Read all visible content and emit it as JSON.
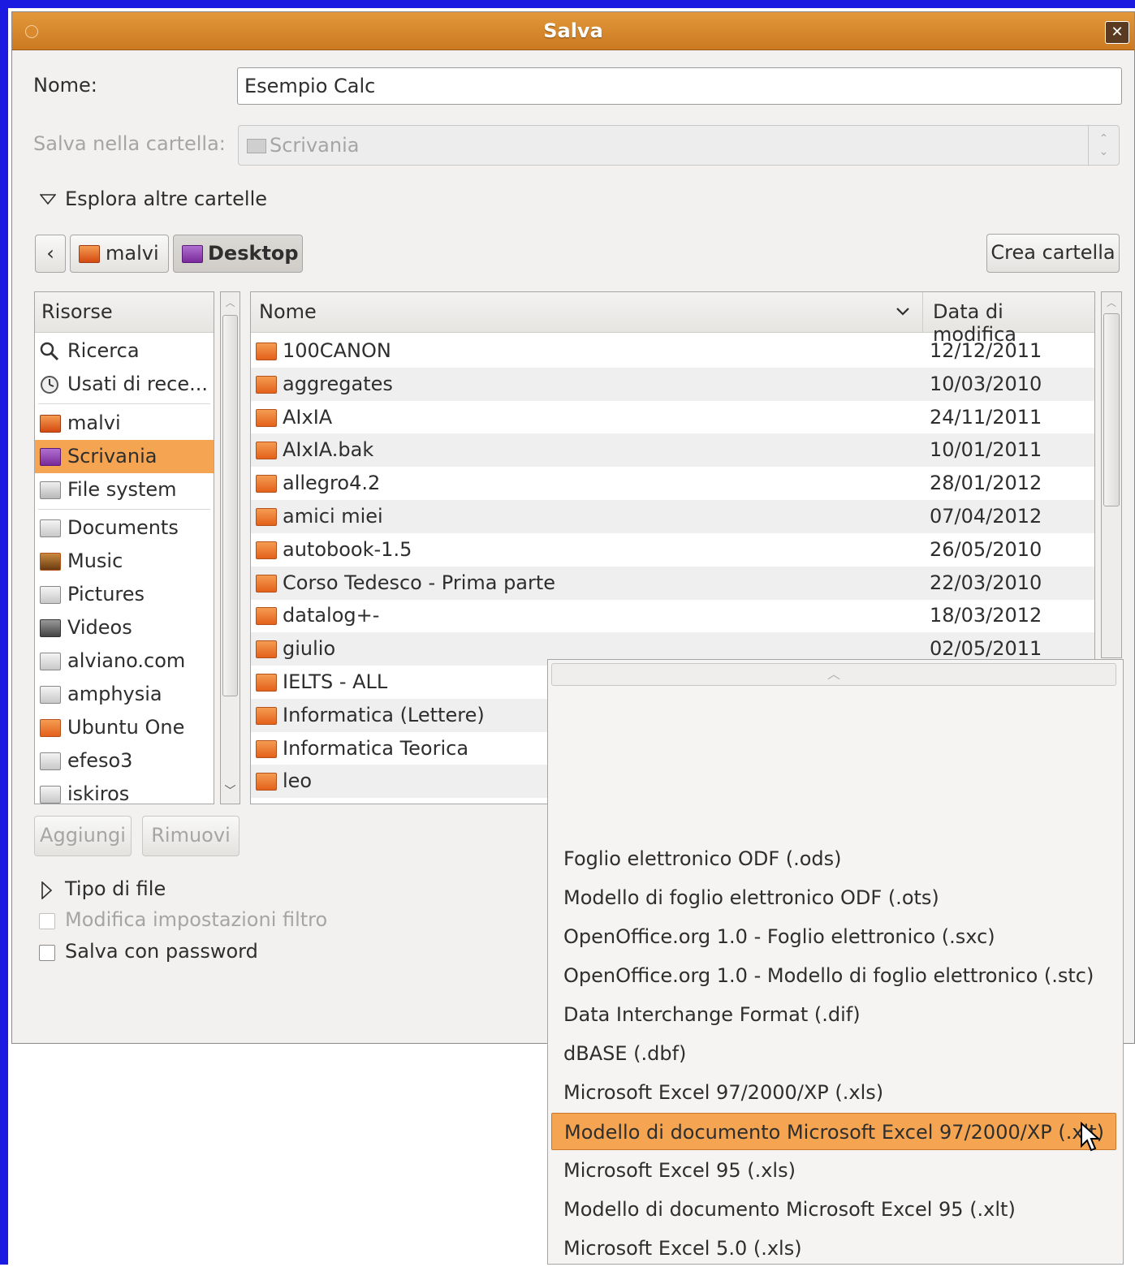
{
  "dialog": {
    "title": "Salva",
    "close_label": "✕",
    "name_label": "Nome:",
    "name_value": "Esempio Calc",
    "folder_label": "Salva nella cartella:",
    "folder_value": "Scrivania",
    "browse_label": "Esplora altre cartelle",
    "path": {
      "back": "‹",
      "crumbs": [
        "malvi",
        "Desktop"
      ]
    },
    "create_folder_label": "Crea cartella",
    "add_label": "Aggiungi",
    "remove_label": "Rimuovi",
    "file_type_label": "Tipo di file",
    "filter_label": "Modifica impostazioni filtro",
    "password_label": "Salva con password"
  },
  "places": {
    "header": "Risorse",
    "items": [
      {
        "label": "Ricerca",
        "icon": "search-icon"
      },
      {
        "label": "Usati di rece...",
        "icon": "recent-icon"
      },
      {
        "label": "malvi",
        "icon": "home-folder-icon"
      },
      {
        "label": "Scrivania",
        "icon": "desktop-icon",
        "selected": true
      },
      {
        "label": "File system",
        "icon": "drive-icon"
      },
      {
        "label": "Documents",
        "icon": "documents-folder-icon"
      },
      {
        "label": "Music",
        "icon": "music-folder-icon"
      },
      {
        "label": "Pictures",
        "icon": "pictures-folder-icon"
      },
      {
        "label": "Videos",
        "icon": "videos-folder-icon"
      },
      {
        "label": "alviano.com",
        "icon": "network-folder-icon"
      },
      {
        "label": "amphysia",
        "icon": "network-folder-icon"
      },
      {
        "label": "Ubuntu One",
        "icon": "folder-icon"
      },
      {
        "label": "efeso3",
        "icon": "network-folder-icon"
      },
      {
        "label": "iskiros",
        "icon": "network-folder-icon"
      }
    ]
  },
  "files": {
    "col_name": "Nome",
    "col_date": "Data di modifica",
    "rows": [
      {
        "name": "100CANON",
        "date": "12/12/2011"
      },
      {
        "name": "aggregates",
        "date": "10/03/2010"
      },
      {
        "name": "AIxIA",
        "date": "24/11/2011"
      },
      {
        "name": "AIxIA.bak",
        "date": "10/01/2011"
      },
      {
        "name": "allegro4.2",
        "date": "28/01/2012"
      },
      {
        "name": "amici miei",
        "date": "07/04/2012"
      },
      {
        "name": "autobook-1.5",
        "date": "26/05/2010"
      },
      {
        "name": "Corso Tedesco - Prima parte",
        "date": "22/03/2010"
      },
      {
        "name": "datalog+-",
        "date": "18/03/2012"
      },
      {
        "name": "giulio",
        "date": "02/05/2011"
      },
      {
        "name": "IELTS - ALL",
        "date": ""
      },
      {
        "name": "Informatica (Lettere)",
        "date": ""
      },
      {
        "name": "Informatica Teorica",
        "date": ""
      },
      {
        "name": "leo",
        "date": ""
      }
    ]
  },
  "filetype_menu": {
    "items": [
      "Foglio elettronico ODF (.ods)",
      "Modello di foglio elettronico ODF (.ots)",
      "OpenOffice.org 1.0 - Foglio elettronico (.sxc)",
      "OpenOffice.org 1.0 - Modello di foglio elettronico (.stc)",
      "Data Interchange Format (.dif)",
      "dBASE (.dbf)",
      "Microsoft Excel 97/2000/XP (.xls)",
      "Modello di documento Microsoft Excel 97/2000/XP (.xlt)",
      "Microsoft Excel 95 (.xls)",
      "Modello di documento Microsoft Excel 95 (.xlt)",
      "Microsoft Excel 5.0 (.xls)"
    ],
    "selected_index": 7
  }
}
